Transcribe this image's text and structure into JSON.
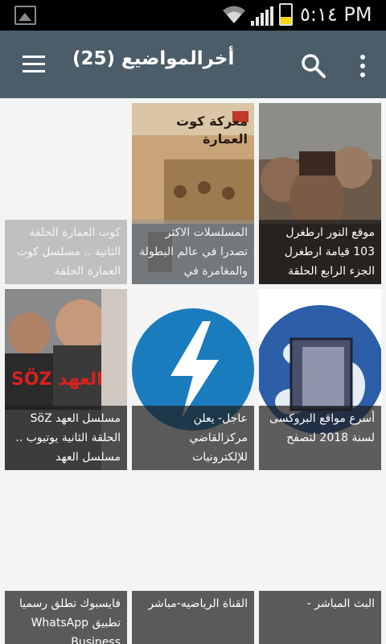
{
  "statusbar": {
    "time": "٥:١٤ PM",
    "icons": [
      "gallery-icon",
      "wifi-icon",
      "signal-icon",
      "battery-icon"
    ]
  },
  "toolbar": {
    "title": "أخرالمواضيع (25)",
    "icons": [
      "menu-icon",
      "search-icon",
      "more-icon"
    ]
  },
  "colors": {
    "toolbar": "#4c5d6a",
    "statusbar": "#000000",
    "background": "#f4f4f4",
    "caption_overlay": "#1e1e1e"
  },
  "posts": [
    {
      "caption": "موقع النور ارطغرل 103 قيامة ارطغرل الجزء الرابع الحلقة"
    },
    {
      "caption": "المسلسلات الاكثر تصدرا في عالم البطولة والمغامرة في",
      "thumb_text": "معركة كوت العمارة"
    },
    {
      "caption": "كوت العمارة الحلقة الثانية .. مسلسل كوت العمارة الحلقة"
    },
    {
      "caption": "أسرع مواقع البروكسى لسنة 2018 لتصفح"
    },
    {
      "caption": "عاجل- يعلن مركزالقاضي للإلكترونيات"
    },
    {
      "caption": "مسلسل العهد SöZ الحلقة الثانية يوتيوب .. مسلسل العهد",
      "thumb_text": "SÖZ العهد"
    },
    {
      "caption": "البث المباشر -"
    },
    {
      "caption": "القناة الرياضيه-مباشر"
    },
    {
      "caption": "فايسبوك تطلق رسميا تطبيق WhatsApp Business"
    }
  ]
}
